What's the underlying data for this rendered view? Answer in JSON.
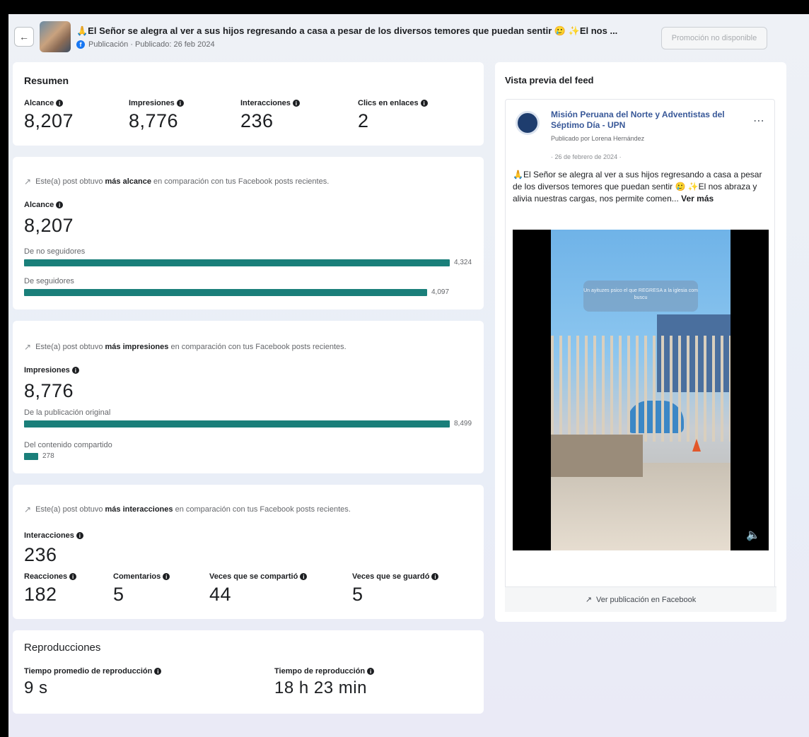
{
  "header": {
    "back_icon": "arrow-left-icon",
    "title": "🙏El Señor se alegra al ver a sus hijos regresando a casa a pesar de los diversos temores que puedan sentir 🥲 ✨El nos ...",
    "meta": "Publicación · Publicado: 26 feb 2024",
    "promo_label": "Promoción no disponible"
  },
  "resumen": {
    "title": "Resumen",
    "metrics": [
      {
        "label": "Alcance",
        "value": "8,207"
      },
      {
        "label": "Impresiones",
        "value": "8,776"
      },
      {
        "label": "Interacciones",
        "value": "236"
      },
      {
        "label": "Clics en enlaces",
        "value": "2"
      }
    ]
  },
  "alcance": {
    "note_pre": "Este(a) post obtuvo ",
    "note_bold": "más alcance",
    "note_post": " en comparación con tus Facebook posts recientes.",
    "label": "Alcance",
    "value": "8,207",
    "rows": [
      {
        "label": "De no seguidores",
        "value": "4,324",
        "fraction": 1.0
      },
      {
        "label": "De seguidores",
        "value": "4,097",
        "fraction": 0.947
      }
    ]
  },
  "impresiones": {
    "note_pre": "Este(a) post obtuvo ",
    "note_bold": "más impresiones",
    "note_post": " en comparación con tus Facebook posts recientes.",
    "label": "Impresiones",
    "value": "8,776",
    "rows": [
      {
        "label": "De la publicación original",
        "value": "8,499",
        "fraction": 1.0
      },
      {
        "label": "Del contenido compartido",
        "value": "278",
        "fraction": 0.033
      }
    ]
  },
  "interacciones": {
    "note_pre": "Este(a) post obtuvo ",
    "note_bold": "más interacciones",
    "note_post": " en comparación con tus Facebook posts recientes.",
    "label": "Interacciones",
    "value": "236",
    "metrics": [
      {
        "label": "Reacciones",
        "value": "182"
      },
      {
        "label": "Comentarios",
        "value": "5"
      },
      {
        "label": "Veces que se compartió",
        "value": "44"
      },
      {
        "label": "Veces que se guardó",
        "value": "5"
      }
    ]
  },
  "reproducciones": {
    "title": "Reproducciones",
    "metrics": [
      {
        "label": "Tiempo promedio de reproducción",
        "value": "9 s"
      },
      {
        "label": "Tiempo de reproducción",
        "value": "18 h 23 min"
      }
    ]
  },
  "preview": {
    "title": "Vista previa del feed",
    "page_name": "Misión Peruana del Norte y Adventistas del Séptimo Día - UPN",
    "posted_by": "Publicado por Lorena Hernández",
    "date": "· 26 de febrero de 2024 ·",
    "text": "🙏El Señor se alegra al ver a sus hijos regresando a casa a pesar de los diversos temores que puedan sentir 🥲 ✨El nos abraza y alivia nuestras cargas, nos permite comen...",
    "see_more": "Ver más",
    "video_overlay": "Un ayituzes psico el que REGRESA a la iglesia com buscu",
    "view_on_facebook": "Ver publicación en Facebook"
  },
  "colors": {
    "bar": "#1a7f7a",
    "link": "#385898",
    "background": "#eef1f6"
  }
}
